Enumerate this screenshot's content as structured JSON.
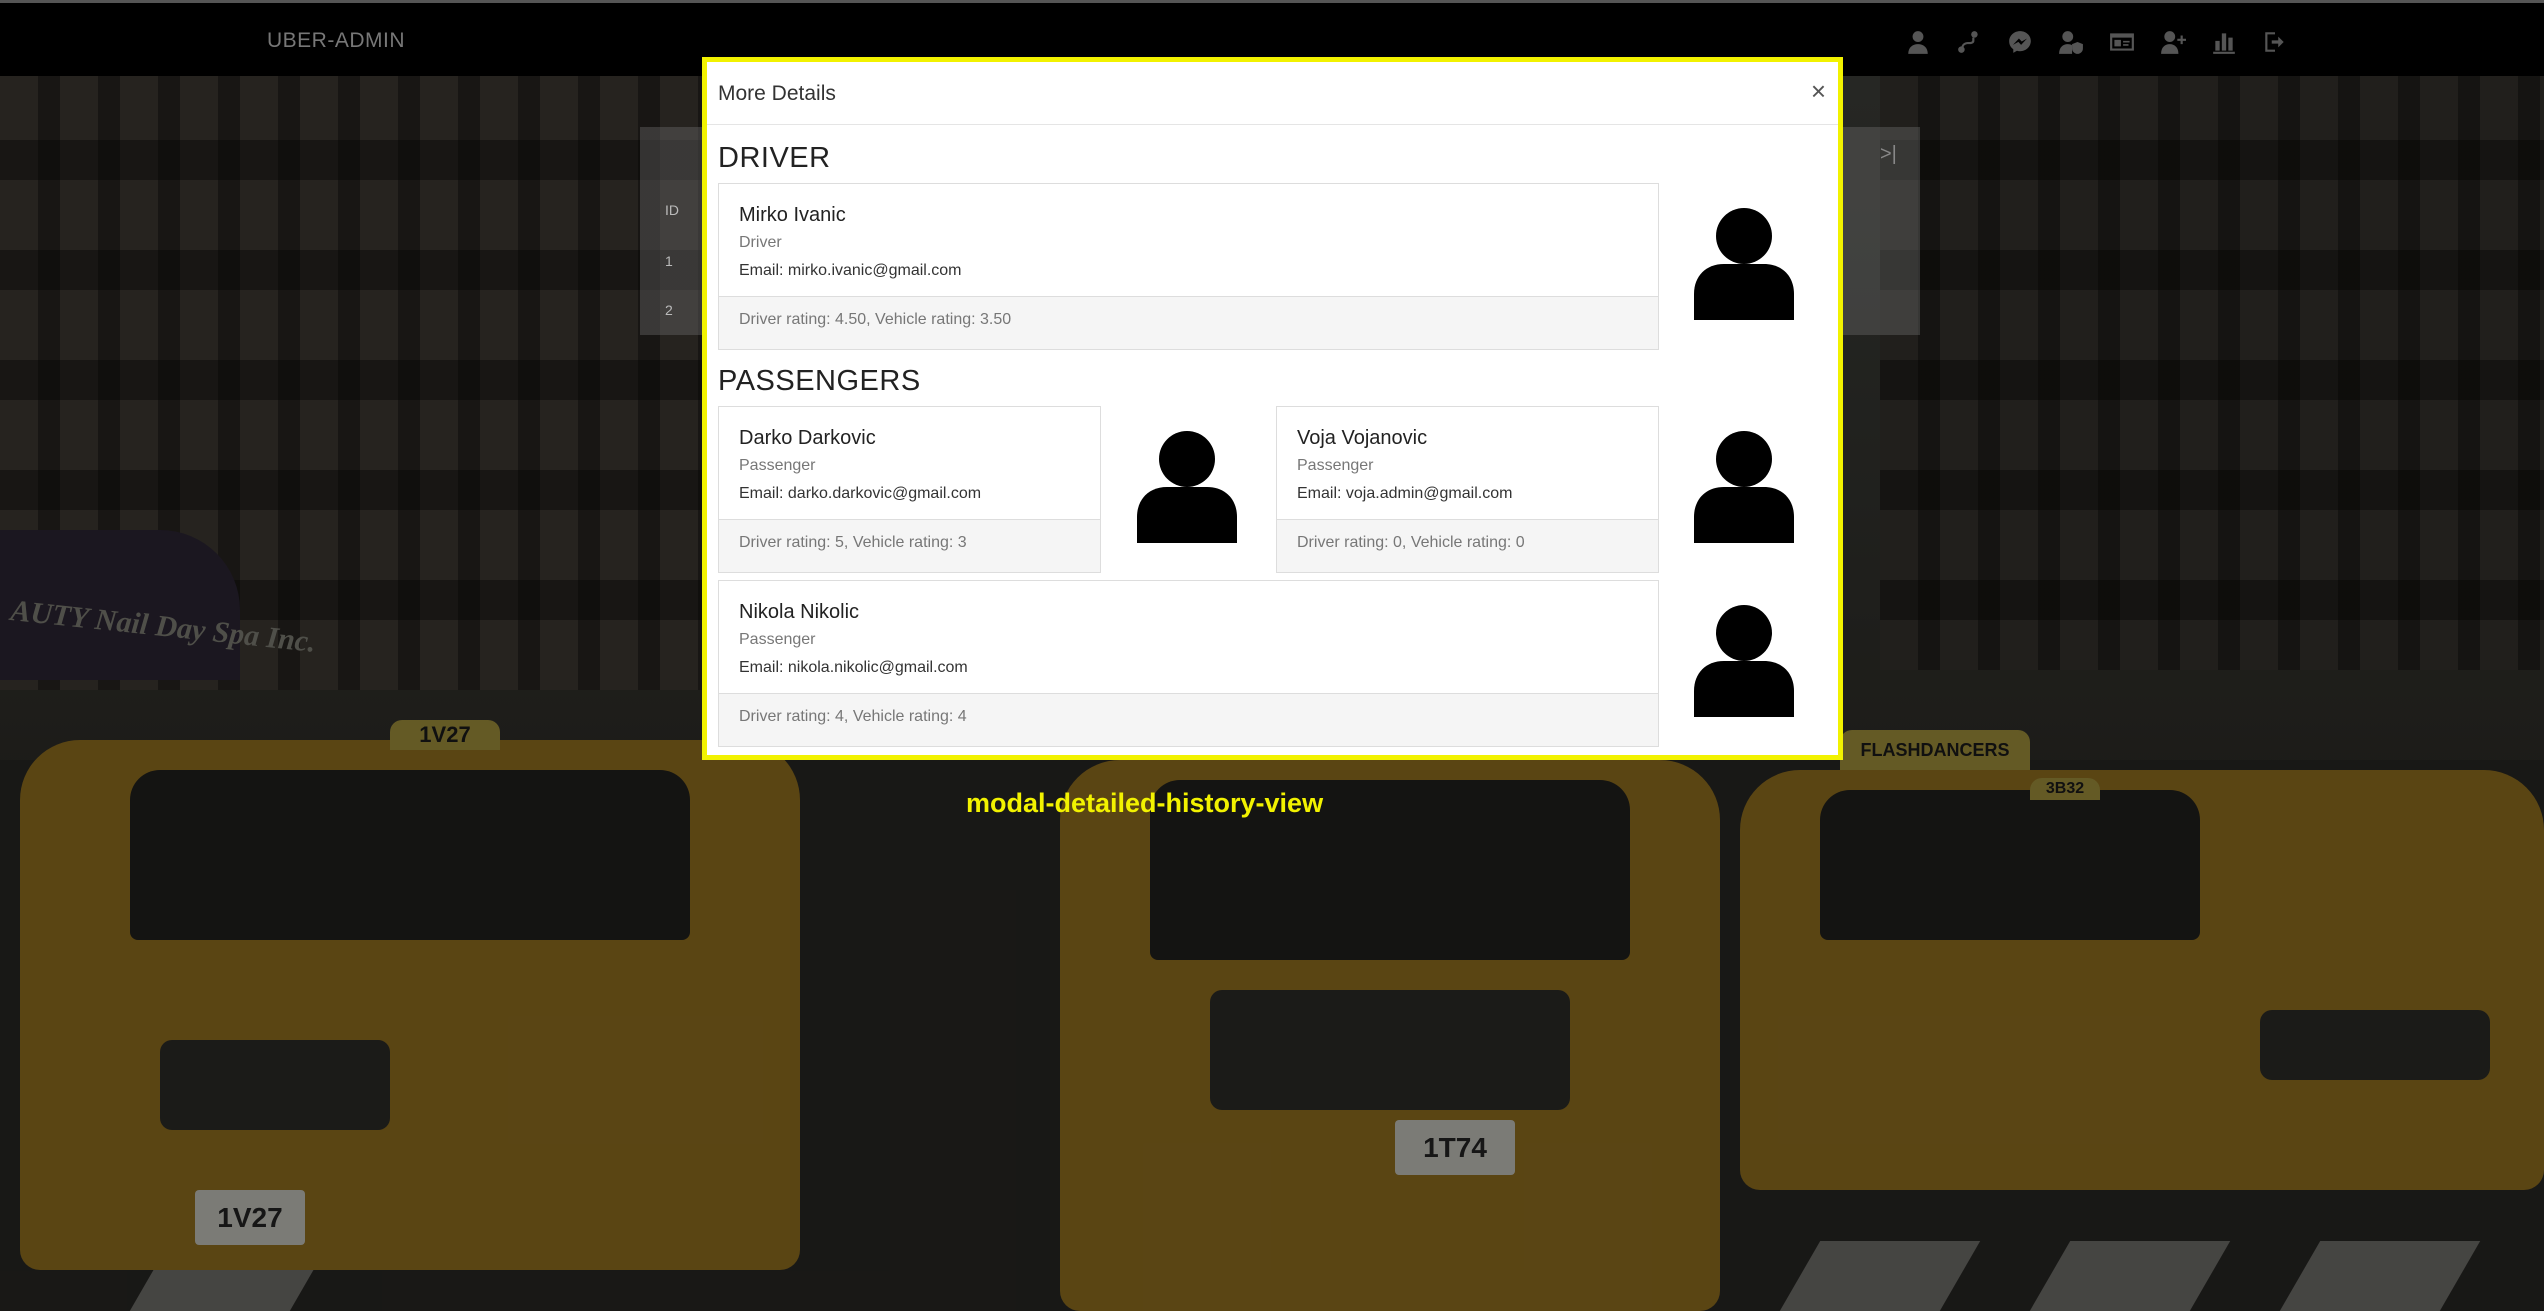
{
  "navbar": {
    "brand": "UBER-ADMIN",
    "icons": [
      "user-icon",
      "route-icon",
      "messenger-icon",
      "user-shield-icon",
      "id-card-icon",
      "add-user-icon",
      "chart-icon",
      "logout-icon"
    ]
  },
  "background_table": {
    "header": "ID",
    "rows": [
      "1",
      "2"
    ],
    "pager_last": ">|"
  },
  "background_scene": {
    "storefront_text": "AUTY Nail Day Spa Inc.",
    "taxi_roof_1": "1V27",
    "taxi_plate_1": "1V27",
    "taxi_plate_2": "1T74",
    "taxi_roof_3": "3B32",
    "taxi_sign_3": "FLASHDANCERS"
  },
  "modal": {
    "title": "More Details",
    "close_label": "×",
    "driver_section": "DRIVER",
    "passengers_section": "PASSENGERS",
    "driver": {
      "name": "Mirko Ivanic",
      "role": "Driver",
      "email": "Email: mirko.ivanic@gmail.com",
      "rating": "Driver rating: 4.50, Vehicle rating: 3.50"
    },
    "passengers": [
      {
        "name": "Darko Darkovic",
        "role": "Passenger",
        "email": "Email: darko.darkovic@gmail.com",
        "rating": "Driver rating: 5, Vehicle rating: 3"
      },
      {
        "name": "Voja Vojanovic",
        "role": "Passenger",
        "email": "Email: voja.admin@gmail.com",
        "rating": "Driver rating: 0, Vehicle rating: 0"
      },
      {
        "name": "Nikola Nikolic",
        "role": "Passenger",
        "email": "Email: nikola.nikolic@gmail.com",
        "rating": "Driver rating: 4, Vehicle rating: 4"
      }
    ]
  },
  "caption": "modal-detailed-history-view",
  "colors": {
    "highlight": "#f2f200",
    "navbar": "#000000"
  }
}
